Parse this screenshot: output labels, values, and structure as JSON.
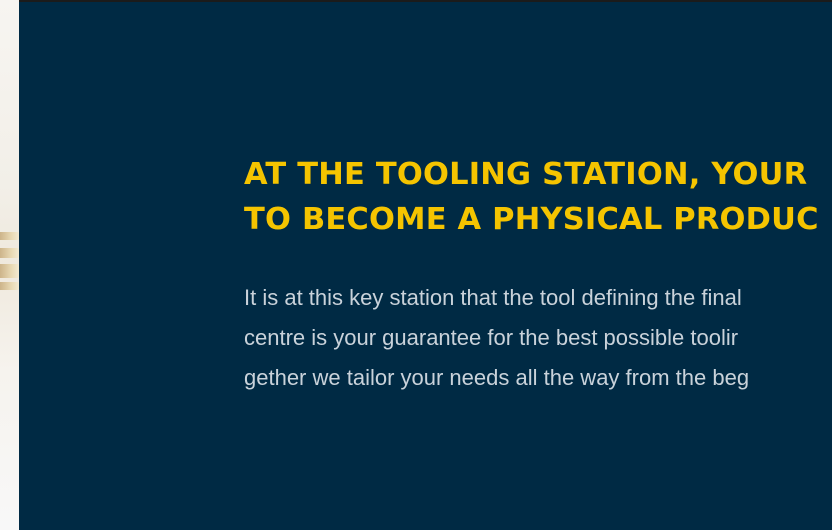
{
  "hero": {
    "headline_lines": [
      "AT THE TOOLING STATION, YOUR",
      "TO BECOME A PHYSICAL PRODUC"
    ],
    "body_lines": [
      "It is at this key station that the tool defining the final",
      "centre is your guarantee for the best possible toolir",
      "gether we tailor your needs all the way from the beg"
    ]
  },
  "colors": {
    "panel_background": "#002a44",
    "headline": "#f5c400",
    "body_text": "#c9d2da"
  }
}
